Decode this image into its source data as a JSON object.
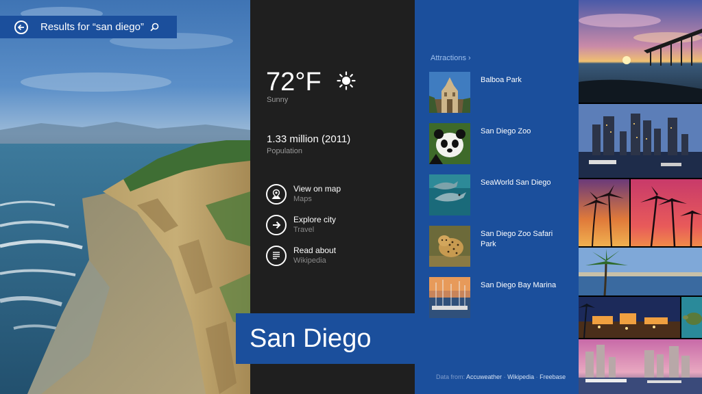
{
  "search": {
    "query_text": "Results for “san diego”"
  },
  "weather": {
    "temperature": "72°F",
    "condition": "Sunny"
  },
  "population": {
    "value": "1.33 million (2011)",
    "label": "Population"
  },
  "actions": [
    {
      "title": "View on map",
      "source": "Maps",
      "icon": "map-pin-icon"
    },
    {
      "title": "Explore city",
      "source": "Travel",
      "icon": "arrow-right-icon"
    },
    {
      "title": "Read about",
      "source": "Wikipedia",
      "icon": "document-lines-icon"
    }
  ],
  "city": {
    "name": "San Diego"
  },
  "attractions": {
    "header": "Attractions ›",
    "items": [
      {
        "name": "Balboa Park"
      },
      {
        "name": "San Diego Zoo"
      },
      {
        "name": "SeaWorld San Diego"
      },
      {
        "name": "San Diego Zoo Safari Park"
      },
      {
        "name": "San Diego Bay Marina"
      }
    ]
  },
  "credits": {
    "prefix": "Data from:",
    "sources": [
      "Accuweather",
      "Wikipedia",
      "Freebase"
    ],
    "separator": "·"
  },
  "colors": {
    "accent": "#1b4f9c",
    "panel_dark": "#1f1f1f"
  }
}
